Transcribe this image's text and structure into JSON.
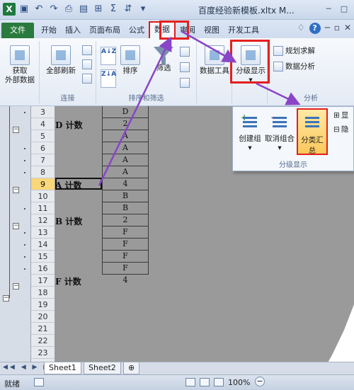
{
  "window": {
    "title": "百度经验新模板.xltx M...",
    "qat_icons": [
      "excel-logo-icon",
      "save-icon",
      "undo-icon",
      "redo-icon",
      "print-preview-icon",
      "form-icon",
      "border-icon",
      "autosum-icon",
      "format-icon",
      "dropdown-icon"
    ],
    "controls": [
      "minimize-icon",
      "maximize-icon",
      "close-icon"
    ]
  },
  "tabs": {
    "items": [
      "文件",
      "开始",
      "插入",
      "页面布局",
      "公式",
      "数据",
      "审阅",
      "视图",
      "开发工具"
    ],
    "active": "数据",
    "right_icons": [
      "ribbon-collapse-icon",
      "help-icon",
      "workbook-minimize-icon",
      "workbook-restore-icon",
      "workbook-close-icon"
    ],
    "help_glyph": "?"
  },
  "ribbon": {
    "get_external": {
      "label_line1": "获取",
      "label_line2": "外部数据"
    },
    "refresh_all": "全部刷新",
    "connections_group": "连接",
    "sort_asc": "A↓Z",
    "sort_desc": "Z↓A",
    "sort": "排序",
    "filter": "筛选",
    "sort_filter_group": "排序和筛选",
    "data_tools": "数据工具",
    "outline": "分级显示",
    "solver": "规划求解",
    "data_analysis": "数据分析",
    "analysis_group": "分析"
  },
  "outline_dropdown": {
    "group": "创建组",
    "ungroup": "取消组合",
    "subtotal": "分类汇总",
    "label": "分级显示",
    "side_items": [
      "显",
      "隐"
    ]
  },
  "sheet": {
    "rows": [
      {
        "num": "3",
        "a": "",
        "c": "D"
      },
      {
        "num": "4",
        "a": "D  计数",
        "c": "2"
      },
      {
        "num": "5",
        "a": "",
        "c": "A"
      },
      {
        "num": "6",
        "a": "",
        "c": "A"
      },
      {
        "num": "7",
        "a": "",
        "c": "A"
      },
      {
        "num": "8",
        "a": "",
        "c": "A"
      },
      {
        "num": "9",
        "a": "A  计数",
        "c": "4"
      },
      {
        "num": "10",
        "a": "",
        "c": "B"
      },
      {
        "num": "11",
        "a": "",
        "c": "B"
      },
      {
        "num": "12",
        "a": "B  计数",
        "c": "2"
      },
      {
        "num": "13",
        "a": "",
        "c": "F"
      },
      {
        "num": "14",
        "a": "",
        "c": "F"
      },
      {
        "num": "15",
        "a": "",
        "c": "F"
      },
      {
        "num": "16",
        "a": "",
        "c": "F"
      },
      {
        "num": "17",
        "a": "F  计数",
        "c": "4"
      },
      {
        "num": "18",
        "a": "",
        "c": ""
      },
      {
        "num": "19",
        "a": "",
        "c": ""
      },
      {
        "num": "20",
        "a": "",
        "c": ""
      },
      {
        "num": "21",
        "a": "",
        "c": ""
      },
      {
        "num": "22",
        "a": "",
        "c": ""
      },
      {
        "num": "23",
        "a": "",
        "c": ""
      }
    ],
    "selected_row": "9",
    "tabs": [
      "Sheet1",
      "Sheet2"
    ],
    "active_tab": "Sheet1"
  },
  "status": {
    "ready": "就绪",
    "zoom": "100%"
  },
  "colors": {
    "highlight": "#e41f1f",
    "arrow": "#8a44c8",
    "file_tab": "#2a7a3d",
    "selected_row": "#f9d77a"
  }
}
